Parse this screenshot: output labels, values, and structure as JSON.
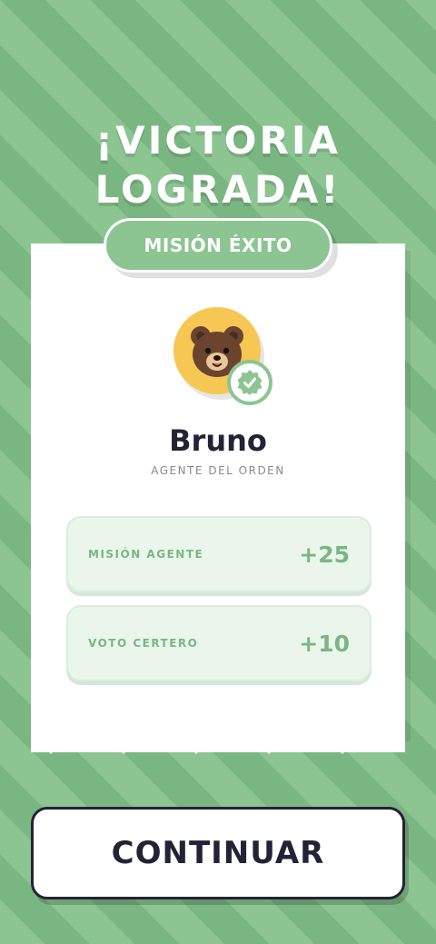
{
  "header": {
    "title_line1": "¡VICTORIA",
    "title_line2": "LOGRADA!"
  },
  "result_badge": "MISIÓN ÉXITO",
  "player": {
    "avatar": "bear-face-icon",
    "status_icon": "verified-check-icon",
    "name": "Bruno",
    "role": "AGENTE DEL ORDEN"
  },
  "rewards": [
    {
      "label": "MISIÓN AGENTE",
      "value": "+25"
    },
    {
      "label": "VOTO CERTERO",
      "value": "+10"
    }
  ],
  "actions": {
    "continue_label": "CONTINUAR"
  },
  "colors": {
    "background": "#8cc592",
    "stripe": "#7ab682",
    "card": "#ffffff",
    "reward_bg": "#eaf6ec",
    "text_dark": "#232336",
    "avatar_bg": "#f6c752"
  }
}
